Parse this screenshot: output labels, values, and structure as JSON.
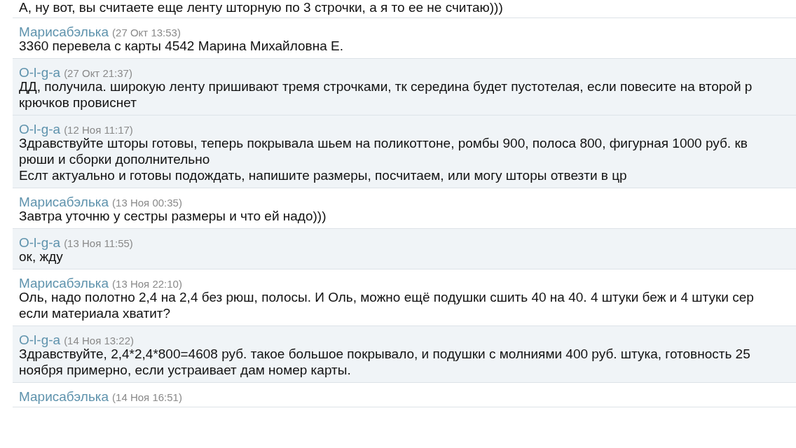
{
  "top_message": {
    "lines": [
      "А, ну вот, вы считаете еще ленту шторную по 3 строчки, а я то ее не считаю)))"
    ]
  },
  "messages": [
    {
      "author": "Марисабэлька",
      "time": "(27 Окт 13:53)",
      "shaded": false,
      "lines": [
        "3360 перевела с карты 4542 Марина Михайловна Е."
      ]
    },
    {
      "author": "O-l-g-a",
      "time": "(27 Окт 21:37)",
      "shaded": true,
      "lines": [
        "ДД, получила. широкую ленту пришивают тремя строчками, тк середина будет пустотелая, если повесите на второй р",
        "крючков провиснет"
      ]
    },
    {
      "author": "O-l-g-a",
      "time": "(12 Ноя 11:17)",
      "shaded": true,
      "lines": [
        "Здравствуйте шторы готовы, теперь покрывала шьем на поликоттоне, ромбы 900, полоса 800, фигурная 1000 руб. кв",
        "рюши и сборки дополнительно",
        "Еслт актуально и готовы подождать, напишите размеры, посчитаем, или могу шторы отвезти в цр"
      ]
    },
    {
      "author": "Марисабэлька",
      "time": "(13 Ноя 00:35)",
      "shaded": false,
      "lines": [
        "Завтра уточню у сестры размеры и что ей надо)))"
      ]
    },
    {
      "author": "O-l-g-a",
      "time": "(13 Ноя 11:55)",
      "shaded": true,
      "lines": [
        "ок, жду"
      ]
    },
    {
      "author": "Марисабэлька",
      "time": "(13 Ноя 22:10)",
      "shaded": false,
      "lines": [
        "Оль, надо полотно 2,4 на 2,4 без рюш, полосы. И Оль, можно ещё подушки сшить 40 на 40. 4 штуки беж и 4 штуки сер",
        "если материала хватит?"
      ]
    },
    {
      "author": "O-l-g-a",
      "time": "(14 Ноя 13:22)",
      "shaded": true,
      "lines": [
        "Здравствуйте, 2,4*2,4*800=4608 руб. такое большое покрывало, и подушки с молниями 400 руб. штука, готовность 25",
        "ноября примерно, если устраивает дам номер карты."
      ]
    },
    {
      "author": "Марисабэлька",
      "time": "(14 Ноя 16:51)",
      "shaded": false
    }
  ]
}
